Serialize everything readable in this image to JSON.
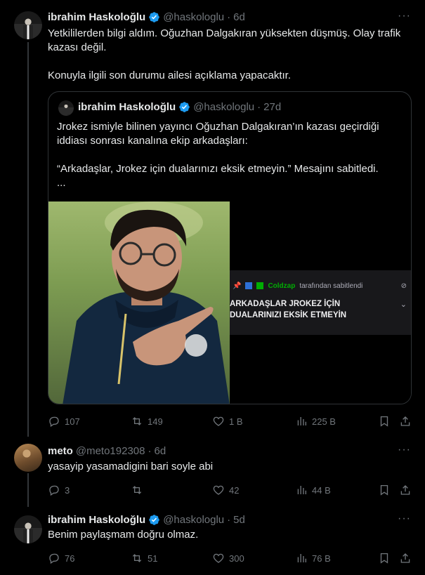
{
  "main_tweet": {
    "author_name": "ibrahim Haskoloğlu",
    "handle": "@haskologlu",
    "separator": "·",
    "time": "6d",
    "more": "···",
    "text_line1": "Yetkililerden bilgi aldım. Oğuzhan Dalgakıran yüksekten düşmüş. Olay trafik kazası değil.",
    "text_line2": "Konuyla ilgili son durumu ailesi açıklama yapacaktır.",
    "quote": {
      "author_name": "ibrahim Haskoloğlu",
      "handle": "@haskologlu",
      "separator": "·",
      "time": "27d",
      "text_line1": "Jrokez ismiyle bilinen yayıncı Oğuzhan Dalgakıran’ın kazası geçirdiği iddiası sonrası kanalına ekip arkadaşları:",
      "text_line2": "“Arkadaşlar, Jrokez için dualarınızı eksik etmeyin.” Mesajını sabitledi.",
      "text_line3": "...",
      "screenshot": {
        "pinned_by_user": "Coldzap",
        "pinned_suffix": "tarafından sabitlendi",
        "message_line1": "ARKADAŞLAR JROKEZ İÇİN",
        "message_line2": "DUALARINIZI EKSİK ETMEYİN"
      }
    },
    "stats": {
      "replies": "107",
      "reposts": "149",
      "likes": "1 B",
      "views": "225 B"
    }
  },
  "reply": {
    "author_name": "meto",
    "handle": "@meto192308",
    "separator": "·",
    "time": "6d",
    "more": "···",
    "text": "yasayip yasamadigini bari soyle abi",
    "stats": {
      "replies": "3",
      "reposts": "",
      "likes": "42",
      "views": "44 B"
    }
  },
  "author_reply": {
    "author_name": "ibrahim Haskoloğlu",
    "handle": "@haskologlu",
    "separator": "·",
    "time": "5d",
    "more": "···",
    "text": "Benim paylaşmam doğru olmaz.",
    "stats": {
      "replies": "76",
      "reposts": "51",
      "likes": "300",
      "views": "76 B"
    }
  },
  "colors": {
    "background": "#000000",
    "verified": "#1d9bf0",
    "muted": "#71767b",
    "text": "#e7e9ea",
    "border": "#2f3336",
    "twitch_green": "#00ad03"
  },
  "icons": [
    "verified-badge-icon",
    "more-icon",
    "reply-icon",
    "repost-icon",
    "like-icon",
    "views-icon",
    "bookmark-icon",
    "share-icon",
    "pin-icon",
    "eye-off-icon",
    "chevron-down-icon"
  ]
}
